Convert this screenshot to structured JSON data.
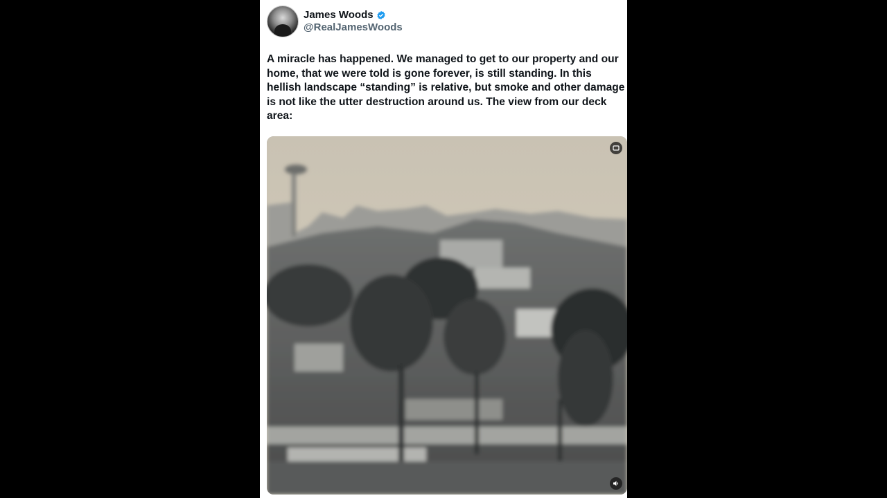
{
  "post": {
    "author": {
      "display_name": "James Woods",
      "handle": "@RealJamesWoods",
      "verified_color": "#1d9bf0"
    },
    "text": "A miracle has happened. We managed to get to our property and our home, that we were told is gone forever, is still standing. In this hellish landscape “standing” is relative, but smoke and other damage is not like the utter destruction around us. The view from our deck area:",
    "media": {
      "type": "video",
      "controls": [
        "fullscreen-icon",
        "volume-icon"
      ]
    }
  }
}
